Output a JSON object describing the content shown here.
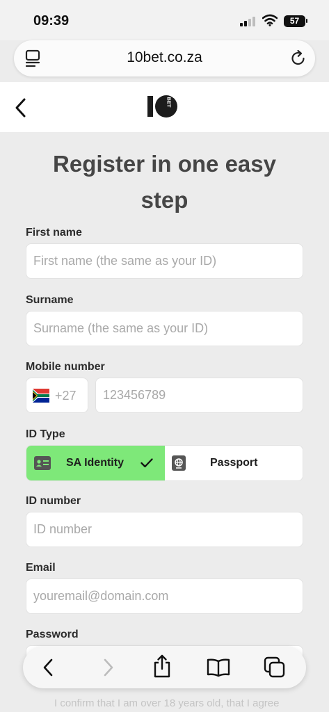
{
  "status_bar": {
    "time": "09:39",
    "battery": "57"
  },
  "browser": {
    "url": "10bet.co.za"
  },
  "header": {
    "logo_main": "10",
    "logo_side": "BET"
  },
  "form": {
    "title": "Register in one easy step",
    "first_name": {
      "label": "First name",
      "placeholder": "First name (the same as your ID)"
    },
    "surname": {
      "label": "Surname",
      "placeholder": "Surname (the same as your ID)"
    },
    "mobile": {
      "label": "Mobile number",
      "prefix": "+27",
      "placeholder": "123456789"
    },
    "id_type": {
      "label": "ID Type",
      "option_sa": "SA Identity",
      "option_passport": "Passport",
      "selected": "SA Identity"
    },
    "id_number": {
      "label": "ID number",
      "placeholder": "ID number"
    },
    "email": {
      "label": "Email",
      "placeholder": "youremail@domain.com"
    },
    "password": {
      "label": "Password"
    }
  },
  "footer": {
    "terms_text": "I confirm that I am over 18 years old, that I agree"
  },
  "colors": {
    "selected_toggle": "#7ee879",
    "page_bg": "#ececec"
  },
  "toolbar_icons": [
    "back-icon",
    "forward-icon",
    "share-icon",
    "bookmarks-icon",
    "tabs-icon"
  ]
}
